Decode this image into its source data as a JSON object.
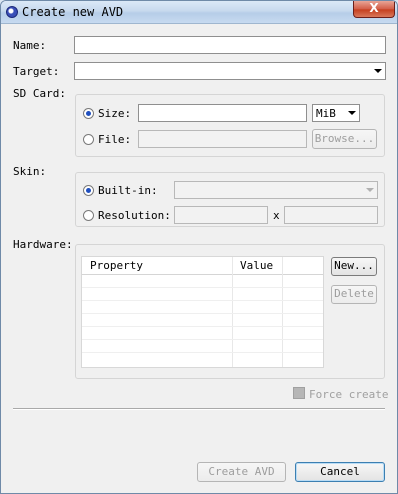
{
  "window": {
    "title": "Create new AVD",
    "close_glyph": "X"
  },
  "form": {
    "name_label": "Name:",
    "name_value": "",
    "target_label": "Target:",
    "target_value": "",
    "sdcard": {
      "label": "SD Card:",
      "size_label": "Size:",
      "size_value": "",
      "unit_value": "MiB",
      "file_label": "File:",
      "file_value": "",
      "browse_label": "Browse..."
    },
    "skin": {
      "label": "Skin:",
      "builtin_label": "Built-in:",
      "builtin_value": "",
      "resolution_label": "Resolution:",
      "res_width": "",
      "res_x": "x",
      "res_height": ""
    },
    "hardware": {
      "label": "Hardware:",
      "columns": [
        "Property",
        "Value"
      ],
      "new_label": "New...",
      "delete_label": "Delete"
    },
    "force_create_label": "Force create"
  },
  "buttons": {
    "create_label": "Create AVD",
    "cancel_label": "Cancel"
  }
}
